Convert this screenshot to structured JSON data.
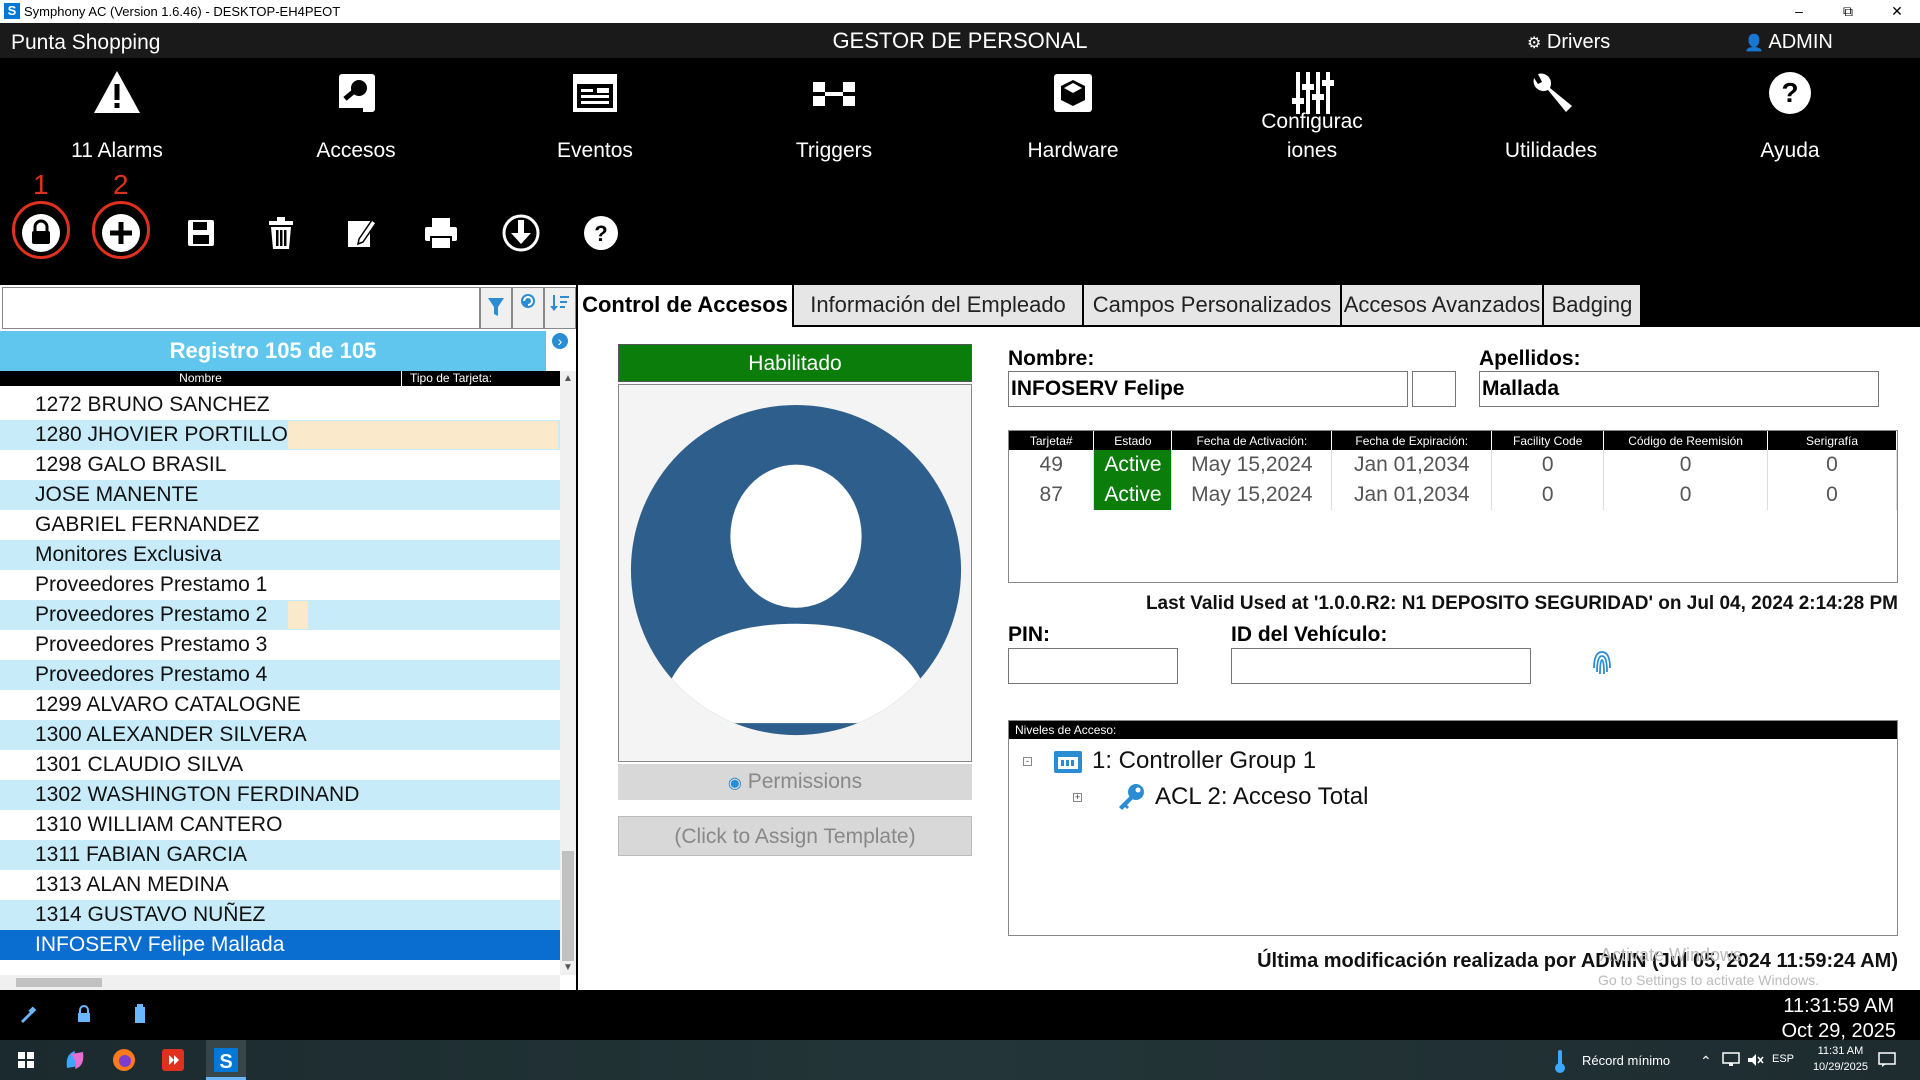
{
  "window": {
    "title": "Symphony AC  (Version 1.6.46) - DESKTOP-EH4PEOT",
    "app_icon_letter": "S"
  },
  "header": {
    "site": "Punta Shopping",
    "title": "GESTOR DE PERSONAL",
    "drivers": "Drivers",
    "user": "ADMIN"
  },
  "nav": [
    {
      "label": "11 Alarms",
      "icon": "warning-icon"
    },
    {
      "label": "Accesos",
      "icon": "access-key-icon"
    },
    {
      "label": "Eventos",
      "icon": "events-icon"
    },
    {
      "label": "Triggers",
      "icon": "triggers-icon"
    },
    {
      "label": "Hardware",
      "icon": "hardware-box-icon"
    },
    {
      "label": "Configurac\niones",
      "icon": "sliders-icon"
    },
    {
      "label": "Utilidades",
      "icon": "wrench-icon"
    },
    {
      "label": "Ayuda",
      "icon": "help-icon"
    }
  ],
  "toolbar": {
    "markers": [
      "1",
      "2"
    ],
    "buttons": [
      "lock-icon",
      "add-icon",
      "save-icon",
      "delete-icon",
      "edit-icon",
      "print-icon",
      "download-icon",
      "help-icon"
    ]
  },
  "left": {
    "search_value": "",
    "record_header": "Registro 105 de 105",
    "col_name": "Nombre",
    "col_card_type": "Tipo de Tarjeta:",
    "items": [
      "1272 BRUNO SANCHEZ",
      "1280 JHOVIER PORTILLO",
      "1298 GALO BRASIL",
      "JOSE  MANENTE",
      "GABRIEL FERNANDEZ",
      "Monitores Exclusiva",
      "Proveedores Prestamo 1",
      "Proveedores Prestamo 2",
      "Proveedores Prestamo 3",
      "Proveedores Prestamo 4",
      "1299 ALVARO CATALOGNE",
      "1300 ALEXANDER SILVERA",
      "1301 CLAUDIO SILVA",
      "1302 WASHINGTON FERDINAND",
      "1310 WILLIAM CANTERO",
      "1311 FABIAN GARCIA",
      "1313 ALAN MEDINA",
      "1314 GUSTAVO NUÑEZ",
      "INFOSERV Felipe Mallada"
    ],
    "selected_index": 18
  },
  "tabs": [
    "Control de Accesos",
    "Información del Empleado",
    "Campos Personalizados",
    "Accesos Avanzados",
    "Badging"
  ],
  "employee": {
    "status": "Habilitado",
    "permissions_label": "Permissions",
    "template_label": "(Click to Assign Template)",
    "nombre_label": "Nombre:",
    "nombre_value": "INFOSERV Felipe",
    "middle_value": "",
    "apellidos_label": "Apellidos:",
    "apellidos_value": "Mallada",
    "pin_label": "PIN:",
    "pin_value": "",
    "vehiculo_label": "ID del Vehículo:",
    "vehiculo_value": "",
    "last_valid": "Last Valid Used at '1.0.0.R2: N1 DEPOSITO SEGURIDAD' on Jul 04, 2024 2:14:28 PM",
    "last_modified": "Última modificación realizada por ADMIN (Jul 05, 2024 11:59:24 AM)"
  },
  "cards_table": {
    "headers": [
      "Tarjeta#",
      "Estado",
      "Fecha de Activación:",
      "Fecha de Expiración:",
      "Facility Code",
      "Código de Reemisión",
      "Serigrafía"
    ],
    "rows": [
      [
        "49",
        "Active",
        "May 15,2024",
        "Jan 01,2034",
        "0",
        "0",
        "0"
      ],
      [
        "87",
        "Active",
        "May 15,2024",
        "Jan 01,2034",
        "0",
        "0",
        "0"
      ]
    ]
  },
  "access_levels": {
    "header": "Niveles de Acceso:",
    "group": "1:  Controller Group 1",
    "acl": "ACL 2:  Acceso Total"
  },
  "watermark": {
    "line1": "Activate Windows",
    "line2": "Go to Settings to activate Windows."
  },
  "status": {
    "time": "11:31:59 AM",
    "date": "Oct 29, 2025"
  },
  "taskbar": {
    "weather": "Récord mínimo",
    "lang": "ESP",
    "time": "11:31 AM",
    "date": "10/29/2025"
  },
  "colors": {
    "accent": "#60c6ed",
    "selected": "#0a6ed1",
    "enabled_green": "#0a7d0a",
    "marker_red": "#e0301e",
    "avatar_blue": "#2e5e8c"
  }
}
